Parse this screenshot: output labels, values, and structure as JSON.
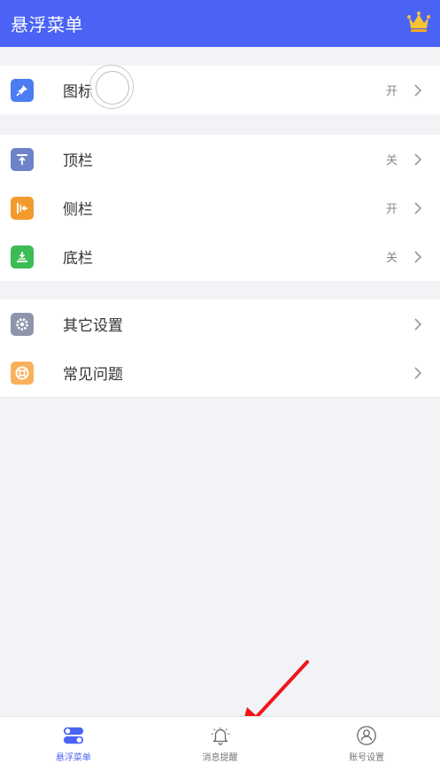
{
  "header": {
    "title": "悬浮菜单",
    "icon": "crown-icon"
  },
  "colors": {
    "primary": "#4a63f5",
    "background": "#f2f3f7",
    "arrow": "#f0161a"
  },
  "groups": [
    {
      "items": [
        {
          "label": "图标",
          "status": "开",
          "icon": "pin-icon",
          "color": "#4c7cf2"
        }
      ]
    },
    {
      "items": [
        {
          "label": "顶栏",
          "status": "关",
          "icon": "top-bar-icon",
          "color": "#6e82c8"
        },
        {
          "label": "侧栏",
          "status": "开",
          "icon": "side-bar-icon",
          "color": "#f39a2f"
        },
        {
          "label": "底栏",
          "status": "关",
          "icon": "bottom-bar-icon",
          "color": "#3dbb55"
        }
      ]
    },
    {
      "items": [
        {
          "label": "其它设置",
          "status": "",
          "icon": "gear-icon",
          "color": "#8f96ab"
        },
        {
          "label": "常见问题",
          "status": "",
          "icon": "lifebuoy-icon",
          "color": "#f8b15a"
        }
      ]
    }
  ],
  "tabs": [
    {
      "label": "悬浮菜单",
      "icon": "toggle-icon",
      "active": true
    },
    {
      "label": "消息提醒",
      "icon": "bell-icon",
      "active": false
    },
    {
      "label": "账号设置",
      "icon": "user-icon",
      "active": false
    }
  ]
}
